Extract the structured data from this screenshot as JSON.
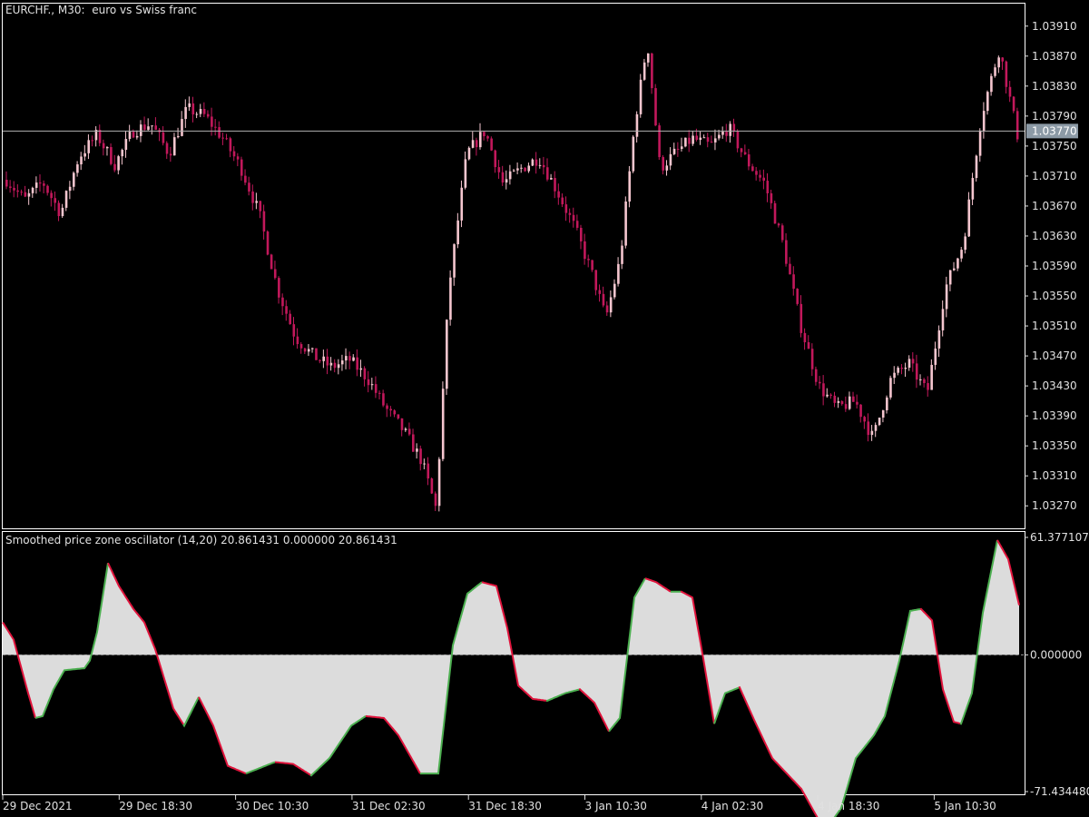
{
  "window": {
    "symbol_title": "EURCHF., M30:  euro vs Swiss franc",
    "indicator_title": "Smoothed price zone oscillator (14,20) 20.861431 0.000000 20.861431"
  },
  "colors": {
    "background": "#000000",
    "grid_border": "#ffffff",
    "bull_candle": "#f5c6cf",
    "bear_candle": "#c2185b",
    "price_line": "#b0b0b0",
    "price_tag_bg": "#8c9aa6",
    "osc_fill": "#dcdcdc",
    "osc_up": "#4caf50",
    "osc_down": "#e0143c",
    "axis_text": "#e0e0e0"
  },
  "chart_data": [
    {
      "type": "candlestick",
      "title": "EURCHF., M30:  euro vs Swiss franc",
      "ylim": [
        1.0324,
        1.0394
      ],
      "y_ticks": [
        "1.03910",
        "1.03870",
        "1.03830",
        "1.03790",
        "1.03750",
        "1.03710",
        "1.03670",
        "1.03630",
        "1.03590",
        "1.03550",
        "1.03510",
        "1.03470",
        "1.03430",
        "1.03390",
        "1.03350",
        "1.03310",
        "1.03270"
      ],
      "current_price": "1.03770",
      "bars": 272,
      "close_path": [
        [
          0,
          1.03705
        ],
        [
          10,
          1.03678
        ],
        [
          20,
          1.03702
        ],
        [
          30,
          1.0366
        ],
        [
          40,
          1.03735
        ],
        [
          50,
          1.03765
        ],
        [
          60,
          1.03725
        ],
        [
          70,
          1.0377
        ],
        [
          80,
          1.0378
        ],
        [
          90,
          1.0374
        ],
        [
          100,
          1.038
        ],
        [
          110,
          1.0379
        ],
        [
          120,
          1.0376
        ],
        [
          130,
          1.0372
        ],
        [
          140,
          1.0366
        ],
        [
          150,
          1.0356
        ],
        [
          160,
          1.03495
        ],
        [
          170,
          1.0347
        ],
        [
          180,
          1.03455
        ],
        [
          190,
          1.03465
        ],
        [
          200,
          1.0344
        ],
        [
          210,
          1.034
        ],
        [
          220,
          1.0337
        ],
        [
          230,
          1.0333
        ],
        [
          238,
          1.03265
        ],
        [
          245,
          1.0356
        ],
        [
          255,
          1.0374
        ],
        [
          265,
          1.0377
        ],
        [
          275,
          1.037
        ],
        [
          285,
          1.0372
        ],
        [
          295,
          1.03735
        ],
        [
          305,
          1.0369
        ],
        [
          315,
          1.0364
        ],
        [
          325,
          1.03575
        ],
        [
          332,
          1.0352
        ],
        [
          340,
          1.036
        ],
        [
          348,
          1.0378
        ],
        [
          355,
          1.0389
        ],
        [
          362,
          1.0372
        ],
        [
          370,
          1.0374
        ],
        [
          380,
          1.0376
        ],
        [
          390,
          1.0375
        ],
        [
          400,
          1.03775
        ],
        [
          410,
          1.0373
        ],
        [
          420,
          1.037
        ],
        [
          430,
          1.0362
        ],
        [
          440,
          1.0351
        ],
        [
          450,
          1.0343
        ],
        [
          460,
          1.034
        ],
        [
          470,
          1.0341
        ],
        [
          480,
          1.0336
        ],
        [
          490,
          1.0344
        ],
        [
          500,
          1.0346
        ],
        [
          510,
          1.0342
        ],
        [
          520,
          1.0356
        ],
        [
          530,
          1.0362
        ],
        [
          540,
          1.0379
        ],
        [
          550,
          1.0388
        ],
        [
          560,
          1.03765
        ]
      ]
    },
    {
      "type": "area",
      "title": "Smoothed price zone oscillator (14,20) 20.861431 0.000000 20.861431",
      "ylim": [
        -71.43448,
        61.377107
      ],
      "y_ticks": [
        "61.377107",
        "0.000000",
        "-71.434480"
      ],
      "zero_level": 0,
      "x_ticks": [
        "29 Dec 2021",
        "29 Dec 18:30",
        "30 Dec 10:30",
        "31 Dec 02:30",
        "31 Dec 18:30",
        "3 Jan 10:30",
        "4 Jan 02:30",
        "4 Jan 18:30",
        "5 Jan 10:30"
      ],
      "values": [
        [
          0,
          17
        ],
        [
          6,
          8
        ],
        [
          14,
          -20
        ],
        [
          18,
          -33
        ],
        [
          22,
          -32
        ],
        [
          28,
          -18
        ],
        [
          34,
          -8
        ],
        [
          45,
          -7
        ],
        [
          48,
          -3
        ],
        [
          52,
          12
        ],
        [
          58,
          48
        ],
        [
          64,
          36
        ],
        [
          72,
          24
        ],
        [
          78,
          17
        ],
        [
          84,
          3
        ],
        [
          94,
          -28
        ],
        [
          100,
          -37
        ],
        [
          108,
          -22
        ],
        [
          116,
          -37
        ],
        [
          124,
          -58
        ],
        [
          134,
          -62
        ],
        [
          150,
          -56
        ],
        [
          160,
          -57
        ],
        [
          170,
          -63
        ],
        [
          180,
          -54
        ],
        [
          192,
          -37
        ],
        [
          200,
          -32
        ],
        [
          210,
          -33
        ],
        [
          218,
          -42
        ],
        [
          230,
          -62
        ],
        [
          240,
          -62
        ],
        [
          248,
          5
        ],
        [
          256,
          32
        ],
        [
          264,
          38
        ],
        [
          272,
          36
        ],
        [
          278,
          14
        ],
        [
          284,
          -16
        ],
        [
          292,
          -23
        ],
        [
          300,
          -24
        ],
        [
          310,
          -20
        ],
        [
          318,
          -18
        ],
        [
          326,
          -25
        ],
        [
          334,
          -40
        ],
        [
          340,
          -33
        ],
        [
          348,
          30
        ],
        [
          354,
          40
        ],
        [
          360,
          38
        ],
        [
          368,
          33
        ],
        [
          374,
          33
        ],
        [
          380,
          30
        ],
        [
          386,
          -2
        ],
        [
          392,
          -36
        ],
        [
          398,
          -20
        ],
        [
          406,
          -17
        ],
        [
          414,
          -34
        ],
        [
          424,
          -54
        ],
        [
          440,
          -70
        ],
        [
          450,
          -87
        ],
        [
          456,
          -88
        ],
        [
          462,
          -80
        ],
        [
          470,
          -54
        ],
        [
          480,
          -42
        ],
        [
          486,
          -32
        ],
        [
          494,
          -3
        ],
        [
          500,
          23
        ],
        [
          506,
          24
        ],
        [
          512,
          18
        ],
        [
          518,
          -18
        ],
        [
          524,
          -35
        ],
        [
          528,
          -36
        ],
        [
          534,
          -20
        ],
        [
          540,
          22
        ],
        [
          548,
          60
        ],
        [
          554,
          50
        ],
        [
          560,
          26
        ]
      ]
    }
  ]
}
